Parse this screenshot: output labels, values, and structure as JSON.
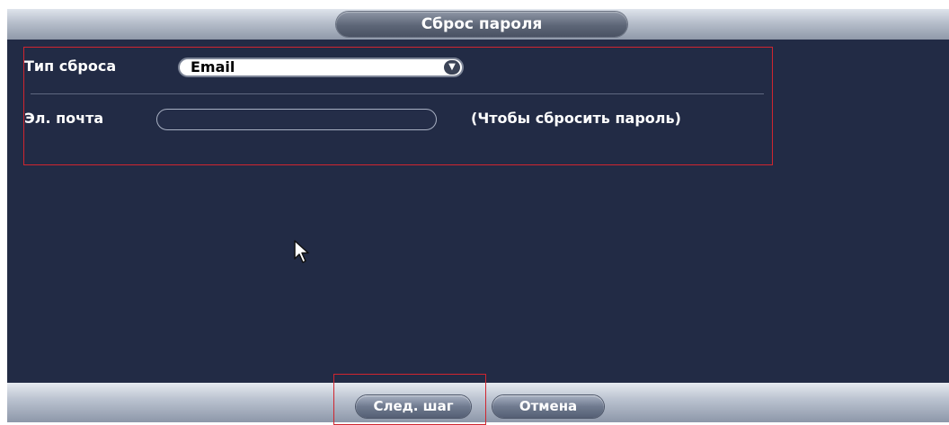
{
  "dialog": {
    "title": "Сброс пароля"
  },
  "form": {
    "reset_type_label": "Тип сброса",
    "reset_type_value": "Email",
    "email_label": "Эл. почта",
    "email_value": "",
    "email_hint": "(Чтобы сбросить пароль)"
  },
  "footer": {
    "next_label": "След. шаг",
    "cancel_label": "Отмена"
  },
  "colors": {
    "background": "#222b45",
    "highlight": "#d0252f",
    "text": "#ffffff"
  },
  "icons": {
    "select_arrow": "chevron-down-icon",
    "cursor": "mouse-pointer-icon"
  }
}
